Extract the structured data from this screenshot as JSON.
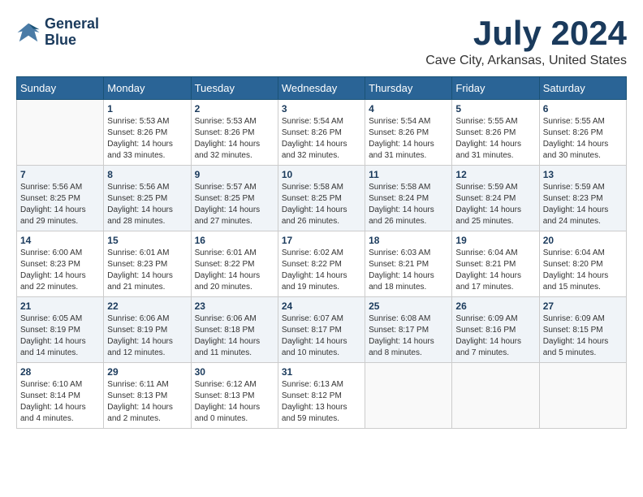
{
  "header": {
    "logo_line1": "General",
    "logo_line2": "Blue",
    "main_title": "July 2024",
    "subtitle": "Cave City, Arkansas, United States"
  },
  "calendar": {
    "days_of_week": [
      "Sunday",
      "Monday",
      "Tuesday",
      "Wednesday",
      "Thursday",
      "Friday",
      "Saturday"
    ],
    "weeks": [
      [
        {
          "day": "",
          "sunrise": "",
          "sunset": "",
          "daylight": ""
        },
        {
          "day": "1",
          "sunrise": "Sunrise: 5:53 AM",
          "sunset": "Sunset: 8:26 PM",
          "daylight": "Daylight: 14 hours and 33 minutes."
        },
        {
          "day": "2",
          "sunrise": "Sunrise: 5:53 AM",
          "sunset": "Sunset: 8:26 PM",
          "daylight": "Daylight: 14 hours and 32 minutes."
        },
        {
          "day": "3",
          "sunrise": "Sunrise: 5:54 AM",
          "sunset": "Sunset: 8:26 PM",
          "daylight": "Daylight: 14 hours and 32 minutes."
        },
        {
          "day": "4",
          "sunrise": "Sunrise: 5:54 AM",
          "sunset": "Sunset: 8:26 PM",
          "daylight": "Daylight: 14 hours and 31 minutes."
        },
        {
          "day": "5",
          "sunrise": "Sunrise: 5:55 AM",
          "sunset": "Sunset: 8:26 PM",
          "daylight": "Daylight: 14 hours and 31 minutes."
        },
        {
          "day": "6",
          "sunrise": "Sunrise: 5:55 AM",
          "sunset": "Sunset: 8:26 PM",
          "daylight": "Daylight: 14 hours and 30 minutes."
        }
      ],
      [
        {
          "day": "7",
          "sunrise": "Sunrise: 5:56 AM",
          "sunset": "Sunset: 8:25 PM",
          "daylight": "Daylight: 14 hours and 29 minutes."
        },
        {
          "day": "8",
          "sunrise": "Sunrise: 5:56 AM",
          "sunset": "Sunset: 8:25 PM",
          "daylight": "Daylight: 14 hours and 28 minutes."
        },
        {
          "day": "9",
          "sunrise": "Sunrise: 5:57 AM",
          "sunset": "Sunset: 8:25 PM",
          "daylight": "Daylight: 14 hours and 27 minutes."
        },
        {
          "day": "10",
          "sunrise": "Sunrise: 5:58 AM",
          "sunset": "Sunset: 8:25 PM",
          "daylight": "Daylight: 14 hours and 26 minutes."
        },
        {
          "day": "11",
          "sunrise": "Sunrise: 5:58 AM",
          "sunset": "Sunset: 8:24 PM",
          "daylight": "Daylight: 14 hours and 26 minutes."
        },
        {
          "day": "12",
          "sunrise": "Sunrise: 5:59 AM",
          "sunset": "Sunset: 8:24 PM",
          "daylight": "Daylight: 14 hours and 25 minutes."
        },
        {
          "day": "13",
          "sunrise": "Sunrise: 5:59 AM",
          "sunset": "Sunset: 8:23 PM",
          "daylight": "Daylight: 14 hours and 24 minutes."
        }
      ],
      [
        {
          "day": "14",
          "sunrise": "Sunrise: 6:00 AM",
          "sunset": "Sunset: 8:23 PM",
          "daylight": "Daylight: 14 hours and 22 minutes."
        },
        {
          "day": "15",
          "sunrise": "Sunrise: 6:01 AM",
          "sunset": "Sunset: 8:23 PM",
          "daylight": "Daylight: 14 hours and 21 minutes."
        },
        {
          "day": "16",
          "sunrise": "Sunrise: 6:01 AM",
          "sunset": "Sunset: 8:22 PM",
          "daylight": "Daylight: 14 hours and 20 minutes."
        },
        {
          "day": "17",
          "sunrise": "Sunrise: 6:02 AM",
          "sunset": "Sunset: 8:22 PM",
          "daylight": "Daylight: 14 hours and 19 minutes."
        },
        {
          "day": "18",
          "sunrise": "Sunrise: 6:03 AM",
          "sunset": "Sunset: 8:21 PM",
          "daylight": "Daylight: 14 hours and 18 minutes."
        },
        {
          "day": "19",
          "sunrise": "Sunrise: 6:04 AM",
          "sunset": "Sunset: 8:21 PM",
          "daylight": "Daylight: 14 hours and 17 minutes."
        },
        {
          "day": "20",
          "sunrise": "Sunrise: 6:04 AM",
          "sunset": "Sunset: 8:20 PM",
          "daylight": "Daylight: 14 hours and 15 minutes."
        }
      ],
      [
        {
          "day": "21",
          "sunrise": "Sunrise: 6:05 AM",
          "sunset": "Sunset: 8:19 PM",
          "daylight": "Daylight: 14 hours and 14 minutes."
        },
        {
          "day": "22",
          "sunrise": "Sunrise: 6:06 AM",
          "sunset": "Sunset: 8:19 PM",
          "daylight": "Daylight: 14 hours and 12 minutes."
        },
        {
          "day": "23",
          "sunrise": "Sunrise: 6:06 AM",
          "sunset": "Sunset: 8:18 PM",
          "daylight": "Daylight: 14 hours and 11 minutes."
        },
        {
          "day": "24",
          "sunrise": "Sunrise: 6:07 AM",
          "sunset": "Sunset: 8:17 PM",
          "daylight": "Daylight: 14 hours and 10 minutes."
        },
        {
          "day": "25",
          "sunrise": "Sunrise: 6:08 AM",
          "sunset": "Sunset: 8:17 PM",
          "daylight": "Daylight: 14 hours and 8 minutes."
        },
        {
          "day": "26",
          "sunrise": "Sunrise: 6:09 AM",
          "sunset": "Sunset: 8:16 PM",
          "daylight": "Daylight: 14 hours and 7 minutes."
        },
        {
          "day": "27",
          "sunrise": "Sunrise: 6:09 AM",
          "sunset": "Sunset: 8:15 PM",
          "daylight": "Daylight: 14 hours and 5 minutes."
        }
      ],
      [
        {
          "day": "28",
          "sunrise": "Sunrise: 6:10 AM",
          "sunset": "Sunset: 8:14 PM",
          "daylight": "Daylight: 14 hours and 4 minutes."
        },
        {
          "day": "29",
          "sunrise": "Sunrise: 6:11 AM",
          "sunset": "Sunset: 8:13 PM",
          "daylight": "Daylight: 14 hours and 2 minutes."
        },
        {
          "day": "30",
          "sunrise": "Sunrise: 6:12 AM",
          "sunset": "Sunset: 8:13 PM",
          "daylight": "Daylight: 14 hours and 0 minutes."
        },
        {
          "day": "31",
          "sunrise": "Sunrise: 6:13 AM",
          "sunset": "Sunset: 8:12 PM",
          "daylight": "Daylight: 13 hours and 59 minutes."
        },
        {
          "day": "",
          "sunrise": "",
          "sunset": "",
          "daylight": ""
        },
        {
          "day": "",
          "sunrise": "",
          "sunset": "",
          "daylight": ""
        },
        {
          "day": "",
          "sunrise": "",
          "sunset": "",
          "daylight": ""
        }
      ]
    ]
  }
}
